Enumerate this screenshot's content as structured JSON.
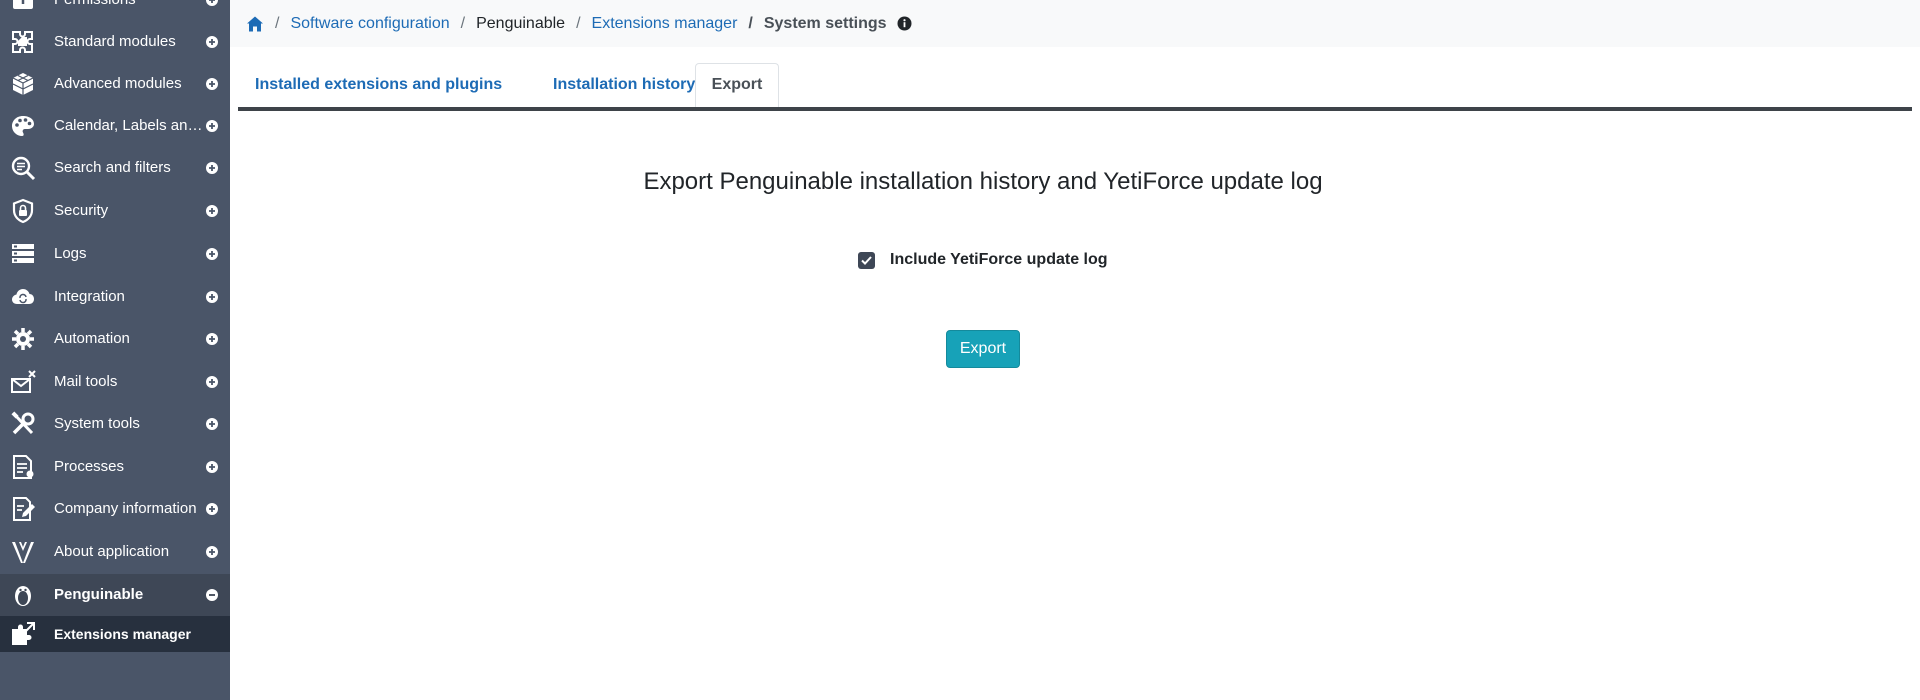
{
  "sidebar": {
    "items": [
      {
        "label": "Permissions",
        "icon": "permissions-icon",
        "toggle": "plus"
      },
      {
        "label": "Standard modules",
        "icon": "puzzle-icon",
        "toggle": "plus"
      },
      {
        "label": "Advanced modules",
        "icon": "cube-icon",
        "toggle": "plus"
      },
      {
        "label": "Calendar, Labels and colors",
        "icon": "palette-icon",
        "toggle": "plus"
      },
      {
        "label": "Search and filters",
        "icon": "search-filter-icon",
        "toggle": "plus"
      },
      {
        "label": "Security",
        "icon": "shield-lock-icon",
        "toggle": "plus"
      },
      {
        "label": "Logs",
        "icon": "server-icon",
        "toggle": "plus"
      },
      {
        "label": "Integration",
        "icon": "cloud-sync-icon",
        "toggle": "plus"
      },
      {
        "label": "Automation",
        "icon": "gears-icon",
        "toggle": "plus"
      },
      {
        "label": "Mail tools",
        "icon": "mail-settings-icon",
        "toggle": "plus"
      },
      {
        "label": "System tools",
        "icon": "tools-icon",
        "toggle": "plus"
      },
      {
        "label": "Processes",
        "icon": "process-document-icon",
        "toggle": "plus"
      },
      {
        "label": "Company information",
        "icon": "edit-document-icon",
        "toggle": "plus"
      },
      {
        "label": "About application",
        "icon": "yetiforce-logo-icon",
        "toggle": "plus"
      },
      {
        "label": "Penguinable",
        "icon": "penguin-icon",
        "toggle": "minus"
      }
    ],
    "subitem": {
      "label": "Extensions manager",
      "icon": "extensions-icon"
    }
  },
  "breadcrumb": {
    "home_icon": "home-icon",
    "items": [
      "Software configuration",
      "Penguinable",
      "Extensions manager",
      "System settings"
    ],
    "info_icon": "info-icon"
  },
  "tabs": [
    {
      "label": "Installed extensions and plugins"
    },
    {
      "label": "Installation history"
    },
    {
      "label": "Export"
    }
  ],
  "content": {
    "title": "Export Penguinable installation history and YetiForce update log",
    "checkbox_label": "Include YetiForce update log",
    "checkbox_checked": true,
    "button_label": "Export"
  },
  "colors": {
    "sidebar_bg": "#4a5568",
    "sidebar_sub_bg": "#27303e",
    "link": "#1d6bb5",
    "button": "#17a2b8"
  }
}
